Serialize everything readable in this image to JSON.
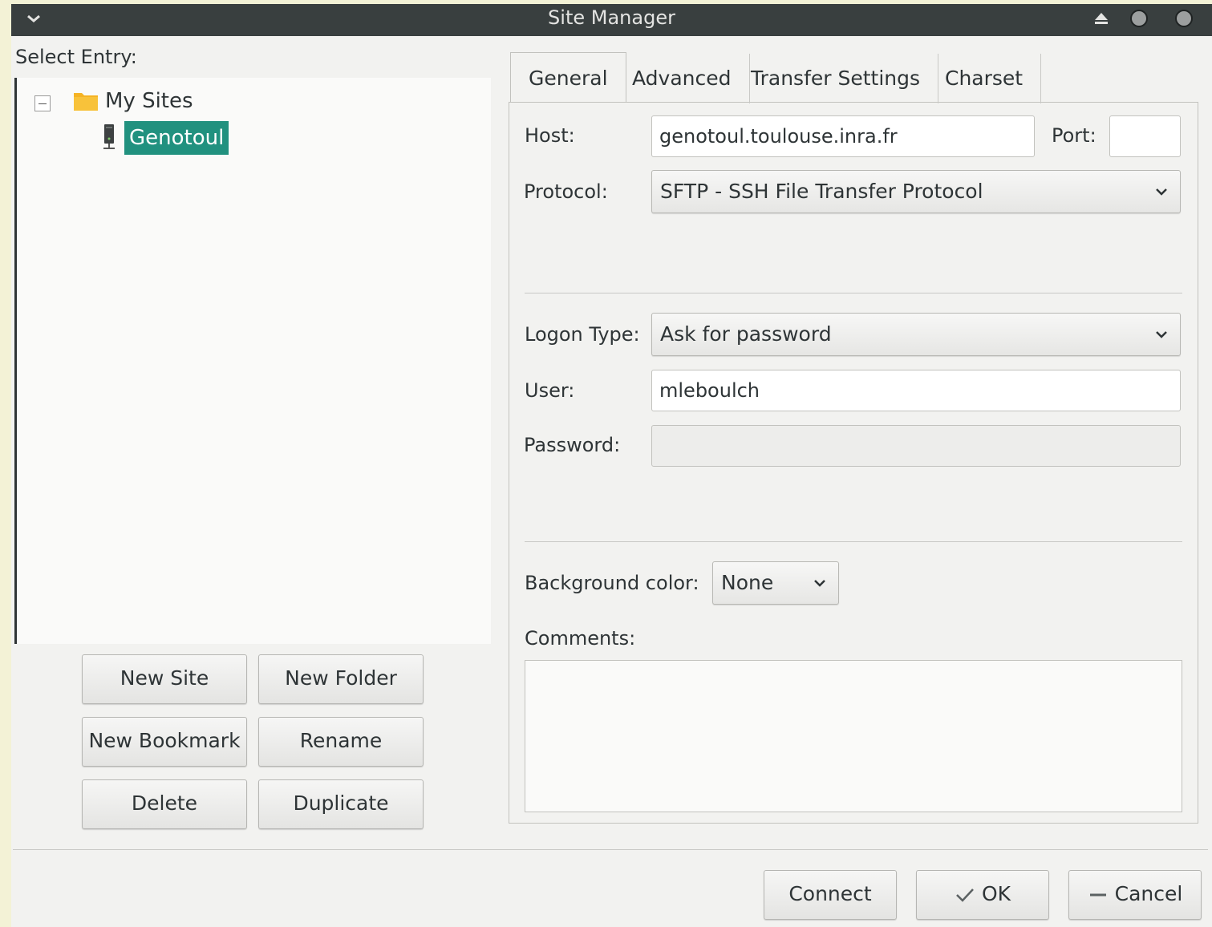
{
  "window": {
    "title": "Site Manager"
  },
  "left": {
    "select_entry_label": "Select Entry:",
    "tree": {
      "folder": "My Sites",
      "site": "Genotoul"
    },
    "buttons": {
      "new_site": "New Site",
      "new_folder": "New Folder",
      "new_bookmark": "New Bookmark",
      "rename": "Rename",
      "delete": "Delete",
      "duplicate": "Duplicate"
    }
  },
  "tabs": [
    "General",
    "Advanced",
    "Transfer Settings",
    "Charset"
  ],
  "general": {
    "host_label": "Host:",
    "host_value": "genotoul.toulouse.inra.fr",
    "port_label": "Port:",
    "port_value": "",
    "protocol_label": "Protocol:",
    "protocol_value": "SFTP - SSH File Transfer Protocol",
    "logon_type_label": "Logon Type:",
    "logon_type_value": "Ask for password",
    "user_label": "User:",
    "user_value": "mleboulch",
    "password_label": "Password:",
    "password_value": "",
    "bgcolor_label": "Background color:",
    "bgcolor_value": "None",
    "comments_label": "Comments:",
    "comments_value": ""
  },
  "footer": {
    "connect": "Connect",
    "ok": "OK",
    "cancel": "Cancel"
  },
  "colors": {
    "titlebar": "#393f3f",
    "selection": "#21917f",
    "window_bg": "#f2f2f0"
  }
}
